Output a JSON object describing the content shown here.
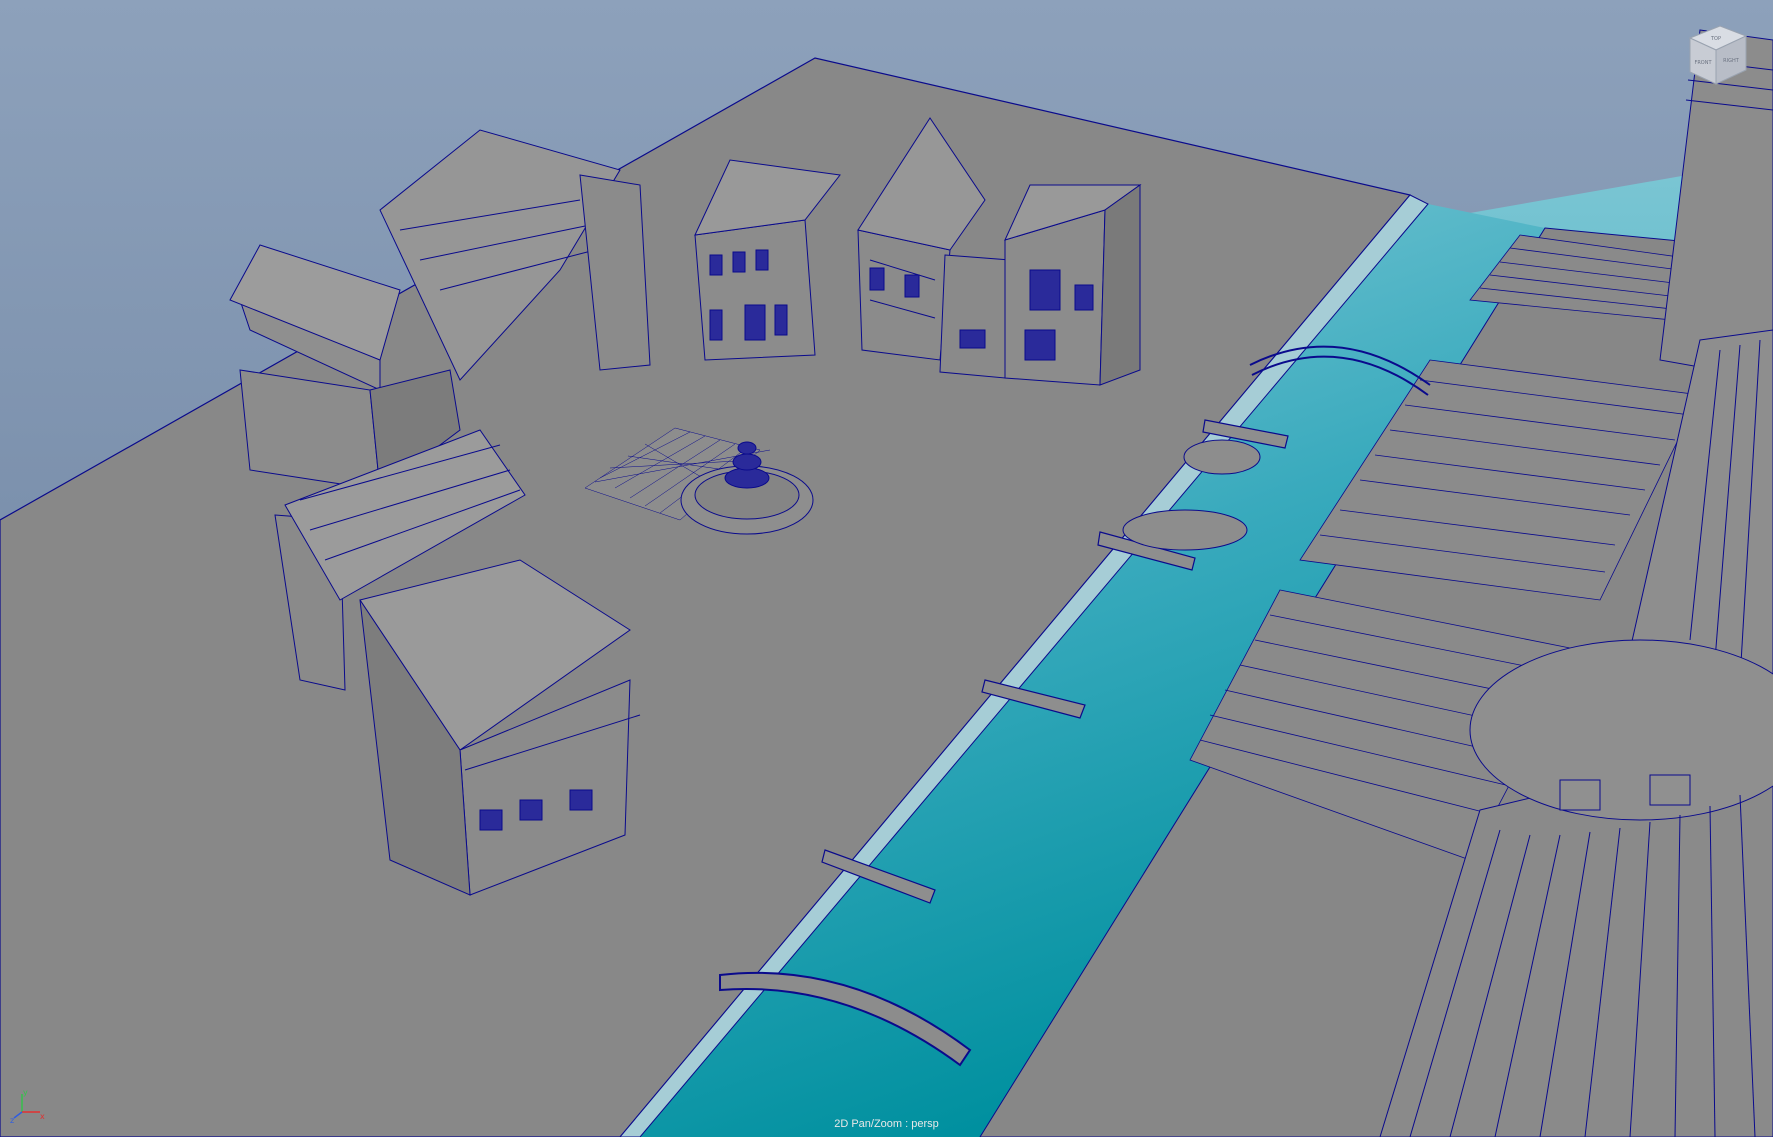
{
  "viewport": {
    "panel_label": "2D Pan/Zoom : persp",
    "camera": "persp",
    "mode": "2D Pan/Zoom"
  },
  "view_cube": {
    "face_top": "TOP",
    "face_front": "FRONT",
    "face_right": "RIGHT"
  },
  "axis_gizmo": {
    "x": "x",
    "y": "y",
    "z": "z"
  },
  "colors": {
    "background_top": "#8da1bb",
    "background_bottom": "#6e86a4",
    "ground": "#888888",
    "wireframe": "#0a0a8c",
    "water_top": "#79c4d3",
    "water_bottom": "#008f9f",
    "axis_x": "#e23030",
    "axis_y": "#36c14b",
    "axis_z": "#2f5de0"
  }
}
